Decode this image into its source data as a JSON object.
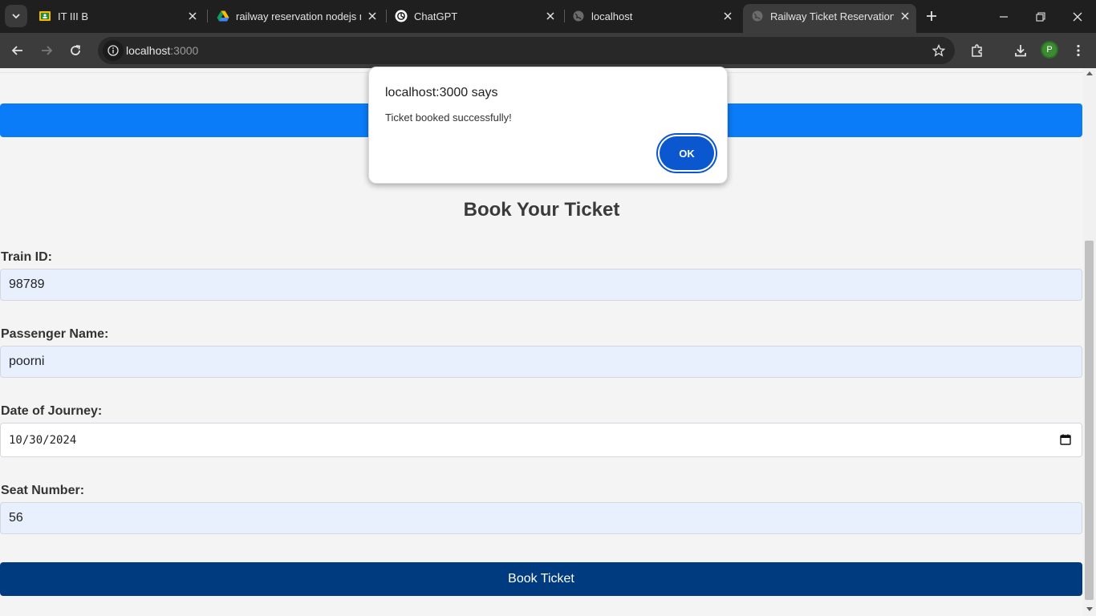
{
  "browser": {
    "tabs": [
      {
        "title": "IT III B",
        "icon": "classroom-icon"
      },
      {
        "title": "railway reservation nodejs m",
        "icon": "google-drive-icon"
      },
      {
        "title": "ChatGPT",
        "icon": "chatgpt-icon"
      },
      {
        "title": "localhost",
        "icon": "globe-icon"
      },
      {
        "title": "Railway Ticket Reservation",
        "icon": "globe-icon",
        "active": true
      }
    ],
    "url_host": "localhost",
    "url_port": ":3000",
    "profile_initial": "P"
  },
  "dialog": {
    "title": "localhost:3000 says",
    "message": "Ticket booked successfully!",
    "ok_label": "OK"
  },
  "form": {
    "heading": "Book Your Ticket",
    "train_id": {
      "label": "Train ID:",
      "value": "98789"
    },
    "passenger_name": {
      "label": "Passenger Name:",
      "value": "poorni"
    },
    "date_of_journey": {
      "label": "Date of Journey:",
      "value": "10/30/2024"
    },
    "seat_number": {
      "label": "Seat Number:",
      "value": "56"
    },
    "submit_label": "Book Ticket"
  },
  "colors": {
    "header_bar": "#0a7cf7",
    "submit_button": "#003b80",
    "input_autofill": "#e8f0fe",
    "dialog_button": "#0b57d0"
  }
}
